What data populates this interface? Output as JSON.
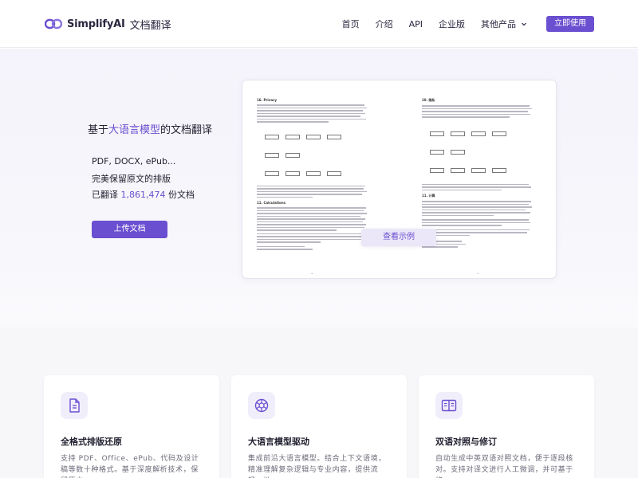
{
  "header": {
    "brand_name": "SimplifyAI",
    "brand_sub": "文档翻译",
    "nav": [
      "首页",
      "介绍",
      "API",
      "企业版",
      "其他产品"
    ],
    "cta": "立即使用"
  },
  "hero": {
    "title_prefix": "基于",
    "title_highlight": "大语言模型",
    "title_suffix": "的文档翻译",
    "formats": "PDF, DOCX, ePub...",
    "layout_note": "完美保留原文的排版",
    "count_prefix": "已翻译",
    "count_value": "1,861,474",
    "count_suffix": "份文档",
    "upload_button": "上传文档",
    "demo_button": "查看示例"
  },
  "preview": {
    "left_heading_1": "16. Privacy",
    "left_heading_2": "11. Calculations",
    "right_heading_1": "10. 隐私",
    "right_heading_2": "11. 计算"
  },
  "features": [
    {
      "title": "全格式排版还原",
      "desc": "支持 PDF、Office、ePub、代码及设计稿等数十种格式。基于深度解析技术，保留原文"
    },
    {
      "title": "大语言模型驱动",
      "desc": "集成前沿大语言模型。结合上下文语境，精准理解复杂逻辑与专业内容，提供流畅、地"
    },
    {
      "title": "双语对照与修订",
      "desc": "自动生成中英双语对照文档，便于逐段核对。支持对译文进行人工微调，并可基于修"
    }
  ],
  "colors": {
    "accent": "#6a4fd0",
    "accent_light": "#f1eefb"
  }
}
